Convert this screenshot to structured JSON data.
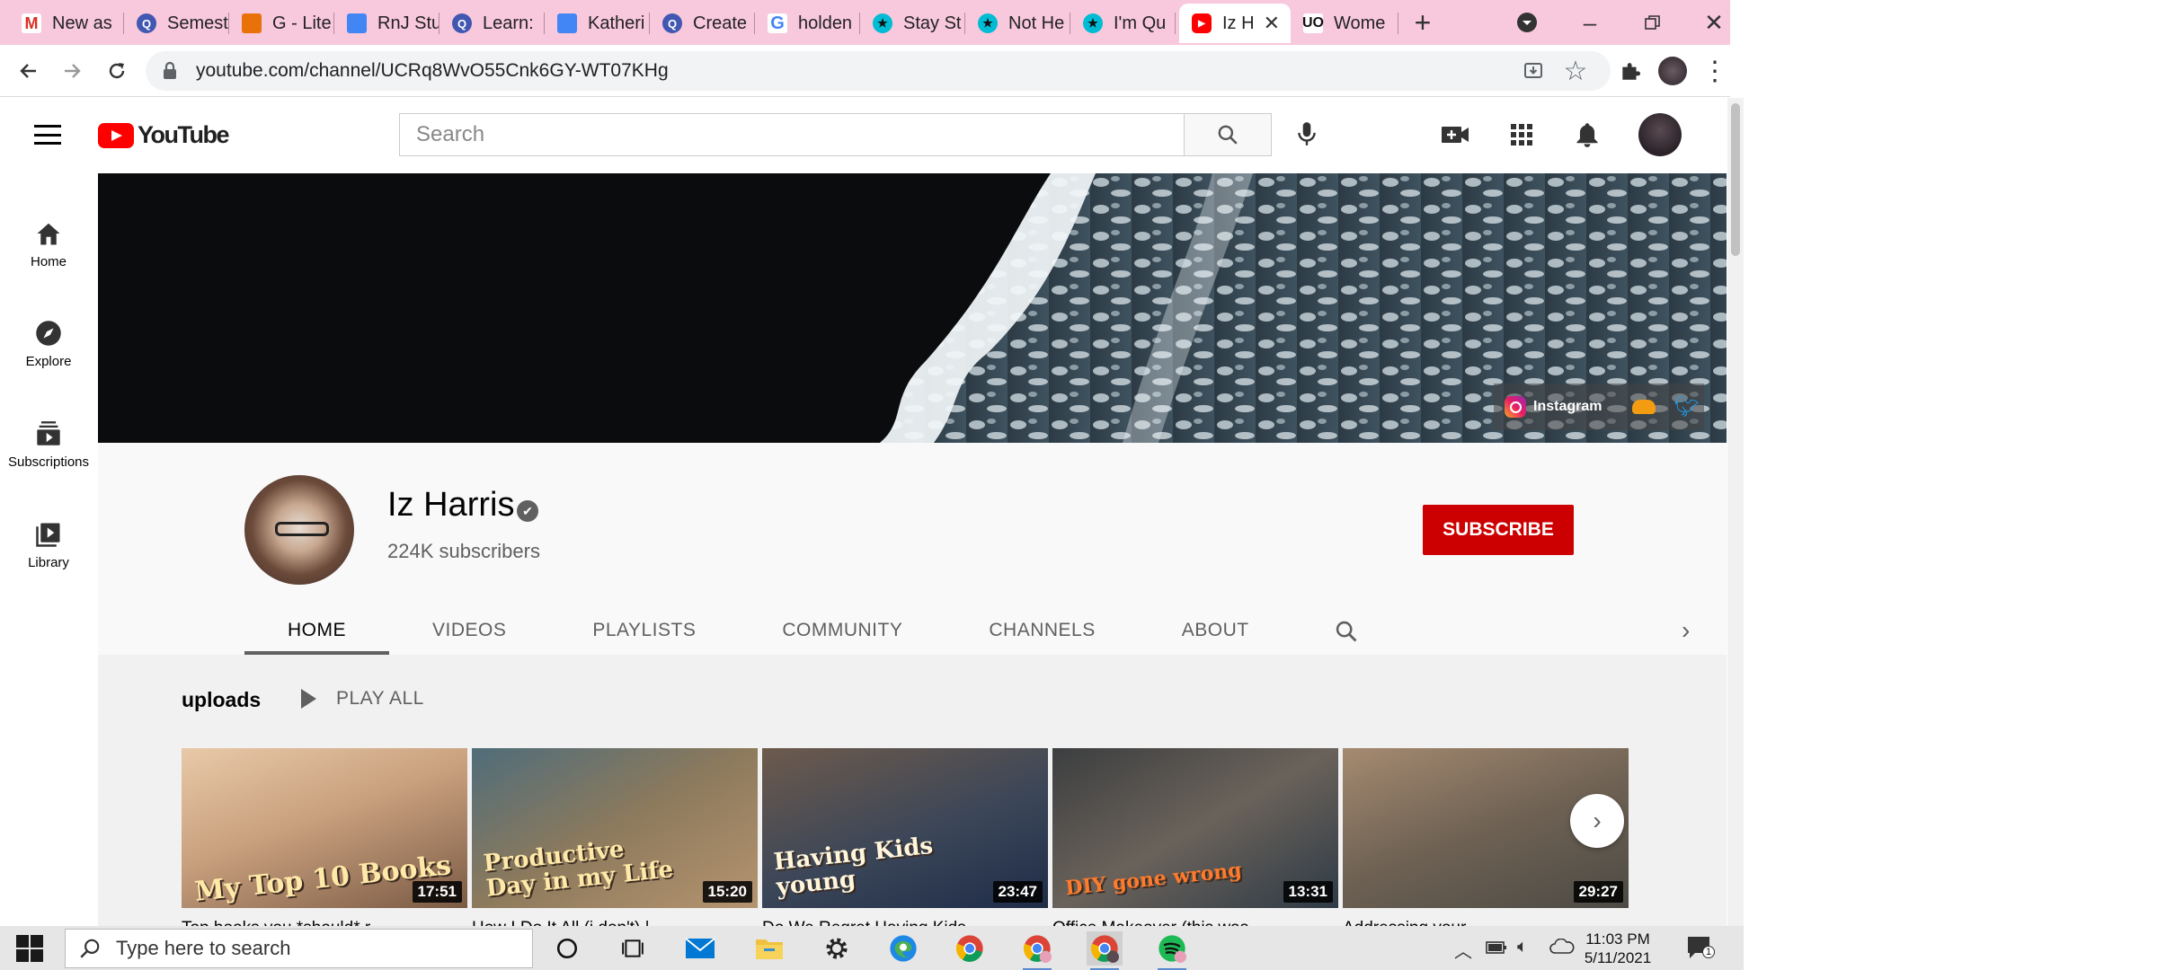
{
  "browser": {
    "tabs": [
      {
        "label": "New as",
        "favicon": "gmail-icon"
      },
      {
        "label": "Semest",
        "favicon": "quizlet-icon"
      },
      {
        "label": "G - Lite",
        "favicon": "slides-icon"
      },
      {
        "label": "RnJ Stu",
        "favicon": "docs-icon"
      },
      {
        "label": "Learn: ",
        "favicon": "quizlet-icon"
      },
      {
        "label": "Katheri",
        "favicon": "docs-icon"
      },
      {
        "label": "Create",
        "favicon": "quizlet-icon"
      },
      {
        "label": "holden",
        "favicon": "google-icon"
      },
      {
        "label": "Stay St",
        "favicon": "star-icon"
      },
      {
        "label": "Not He",
        "favicon": "star-icon"
      },
      {
        "label": "I'm Qu",
        "favicon": "star-icon"
      },
      {
        "label": "Iz H",
        "favicon": "youtube-icon",
        "active": true
      },
      {
        "label": "Wome",
        "favicon": "uo-icon"
      }
    ],
    "url": "youtube.com/channel/UCRq8WvO55Cnk6GY-WT07KHg",
    "colors": {
      "tabstrip": "#f8c8dc",
      "accent": "#1a73e8"
    }
  },
  "youtube": {
    "logo_text": "YouTube",
    "search": {
      "placeholder": "Search"
    },
    "sidebar": [
      {
        "label": "Home",
        "icon": "home-icon"
      },
      {
        "label": "Explore",
        "icon": "compass-icon"
      },
      {
        "label": "Subscriptions",
        "icon": "subscriptions-icon"
      },
      {
        "label": "Library",
        "icon": "library-icon"
      }
    ],
    "banner_links": {
      "instagram": "Instagram"
    },
    "channel": {
      "name": "Iz Harris",
      "subscribers": "224K subscribers",
      "subscribe_label": "SUBSCRIBE",
      "tabs": [
        "HOME",
        "VIDEOS",
        "PLAYLISTS",
        "COMMUNITY",
        "CHANNELS",
        "ABOUT"
      ],
      "active_tab": "HOME"
    },
    "shelf": {
      "title": "uploads",
      "play_all": "PLAY ALL",
      "videos": [
        {
          "thumb_text": "My Top 10 Books",
          "duration": "17:51",
          "title": "Top books you *should* r..."
        },
        {
          "thumb_text": "Productive\nDay in my Life",
          "duration": "15:20",
          "title": "How I Do It All (i don't) |"
        },
        {
          "thumb_text": "Having Kids\nyoung",
          "duration": "23:47",
          "title": "Do We Regret Having Kids"
        },
        {
          "thumb_text": "DIY gone wrong",
          "duration": "13:31",
          "title": "Office Makeover (this was"
        },
        {
          "thumb_text": "",
          "duration": "29:27",
          "title": "Addressing your"
        }
      ]
    }
  },
  "taskbar": {
    "search_placeholder": "Type here to search",
    "time": "11:03 PM",
    "date": "5/11/2021",
    "notification_count": "1"
  }
}
